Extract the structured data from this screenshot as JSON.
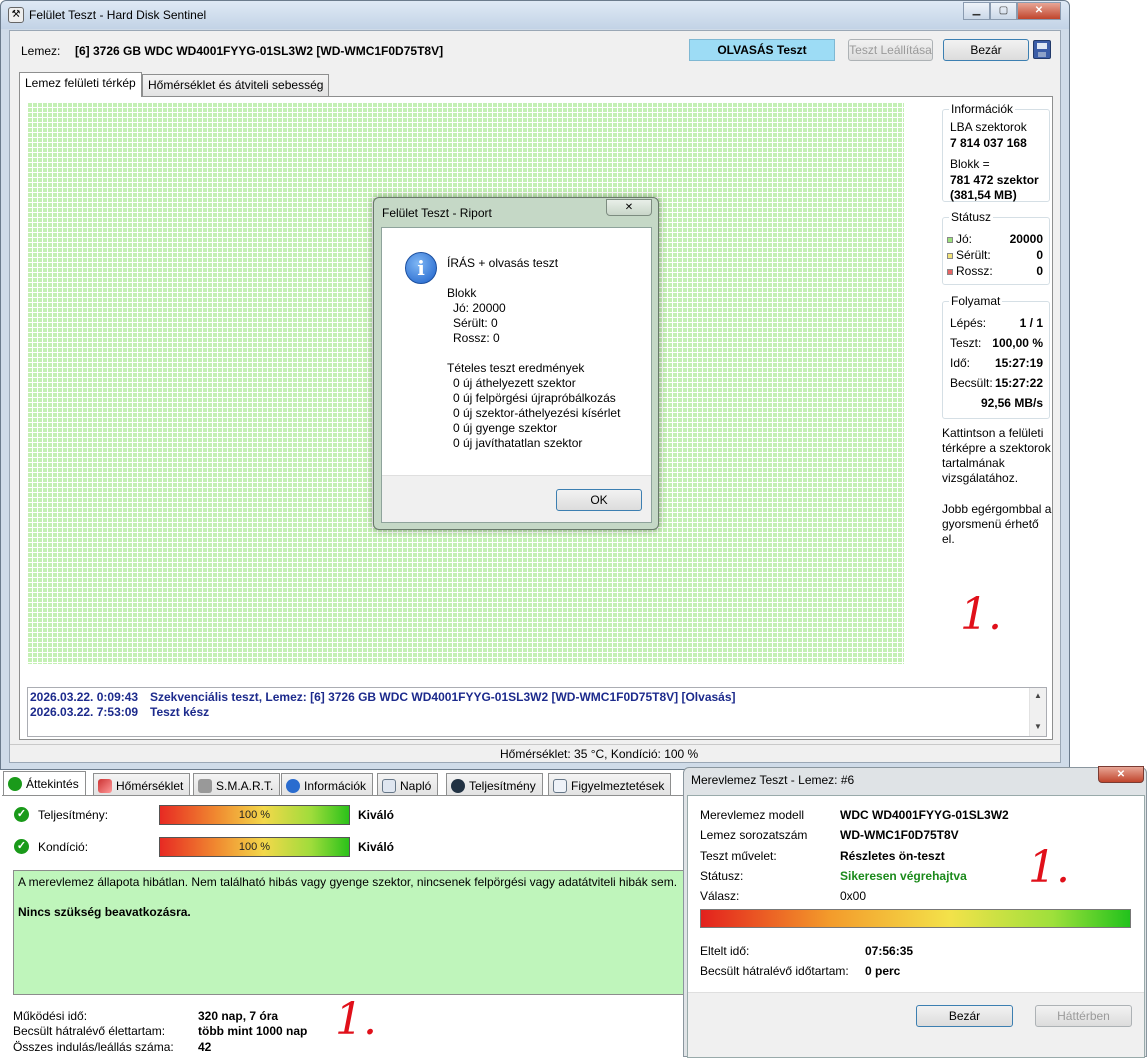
{
  "main_window": {
    "title": "Felület Teszt - Hard Disk Sentinel",
    "disk_label": "Lemez:",
    "disk_value": "[6] 3726 GB  WDC WD4001FYYG-01SL3W2 [WD-WMC1F0D75T8V]",
    "test_status": "OLVASÁS Teszt",
    "stop_button": "Teszt Leállítása",
    "close_button": "Bezár",
    "tabs": [
      "Lemez felületi térkép",
      "Hőmérséklet és átviteli sebesség"
    ],
    "info": {
      "title": "Információk",
      "lba_label": "LBA szektorok",
      "lba_value": "7 814 037 168",
      "block_label": "Blokk =",
      "block_value": "781 472 szektor",
      "block_size": "(381,54 MB)"
    },
    "status": {
      "title": "Státusz",
      "good_label": "Jó:",
      "good_value": "20000",
      "damaged_label": "Sérült:",
      "damaged_value": "0",
      "bad_label": "Rossz:",
      "bad_value": "0",
      "good_color": "#9be27c",
      "damaged_color": "#f3e47a",
      "bad_color": "#e86464"
    },
    "progress": {
      "title": "Folyamat",
      "step_label": "Lépés:",
      "step_value": "1 / 1",
      "test_label": "Teszt:",
      "test_value": "100,00 %",
      "time_label": "Idő:",
      "time_value": "15:27:19",
      "est_label": "Becsült:",
      "est_value": "15:27:22",
      "speed": "92,56 MB/s"
    },
    "hint1": "Kattintson a felületi térképre a szektorok tartalmának vizsgálatához.",
    "hint2": "Jobb egérgombbal a gyorsmenü érhető el.",
    "annotation": "1.",
    "log": [
      {
        "time": "2026.03.22.  0:09:43",
        "text": "Szekvenciális teszt, Lemez: [6] 3726 GB  WDC WD4001FYYG-01SL3W2 [WD-WMC1F0D75T8V] [Olvasás]"
      },
      {
        "time": "2026.03.22.  7:53:09",
        "text": "Teszt kész"
      }
    ],
    "statusbar": "Hőmérséklet: 35  °C,  Kondíció: 100 %"
  },
  "report_dialog": {
    "title": "Felület Teszt - Riport",
    "close_glyph": "✕",
    "heading": "ÍRÁS + olvasás teszt",
    "block_title": "Blokk",
    "good": "Jó: 20000",
    "damaged": "Sérült: 0",
    "bad": "Rossz: 0",
    "results_title": "Tételes teszt eredmények",
    "results": [
      "0 új áthelyezett szektor",
      "0 új felpörgési újrapróbálkozás",
      "0 új szektor-áthelyezési kísérlet",
      "0 új gyenge szektor",
      "0 új javíthatatlan szektor"
    ],
    "ok": "OK"
  },
  "bottom_panel": {
    "tabs": [
      "Áttekintés",
      "Hőmérséklet",
      "S.M.A.R.T.",
      "Információk",
      "Napló",
      "Teljesítmény",
      "Figyelmeztetések"
    ],
    "performance_label": "Teljesítmény:",
    "performance_value": "100 %",
    "performance_rating": "Kiváló",
    "condition_label": "Kondíció:",
    "condition_value": "100 %",
    "condition_rating": "Kiváló",
    "message": "A merevlemez állapota hibátlan. Nem található hibás vagy gyenge szektor, nincsenek felpörgési vagy adatátviteli hibák sem.",
    "message_bold": "Nincs szükség beavatkozásra.",
    "uptime_label": "Működési idő:",
    "uptime_value": "320 nap, 7 óra",
    "remaining_label": "Becsült hátralévő élettartam:",
    "remaining_value": "több mint 1000 nap",
    "startstop_label": "Összes indulás/leállás száma:",
    "startstop_value": "42",
    "annotation": "1."
  },
  "selftest_dialog": {
    "title": "Merevlemez Teszt - Lemez: #6",
    "close_glyph": "✕",
    "rows": [
      {
        "label": "Merevlemez modell",
        "value": "WDC WD4001FYYG-01SL3W2"
      },
      {
        "label": "Lemez sorozatszám",
        "value": "WD-WMC1F0D75T8V"
      },
      {
        "label": "Teszt művelet:",
        "value": "Részletes ön-teszt"
      },
      {
        "label": "Státusz:",
        "value": "Sikeresen végrehajtva"
      },
      {
        "label": "Válasz:",
        "value": "0x00"
      }
    ],
    "elapsed_label": "Eltelt idő:",
    "elapsed_value": "07:56:35",
    "remaining_label": "Becsült hátralévő időtartam:",
    "remaining_value": "0 perc",
    "close_button": "Bezár",
    "background_button": "Háttérben",
    "annotation": "1."
  }
}
